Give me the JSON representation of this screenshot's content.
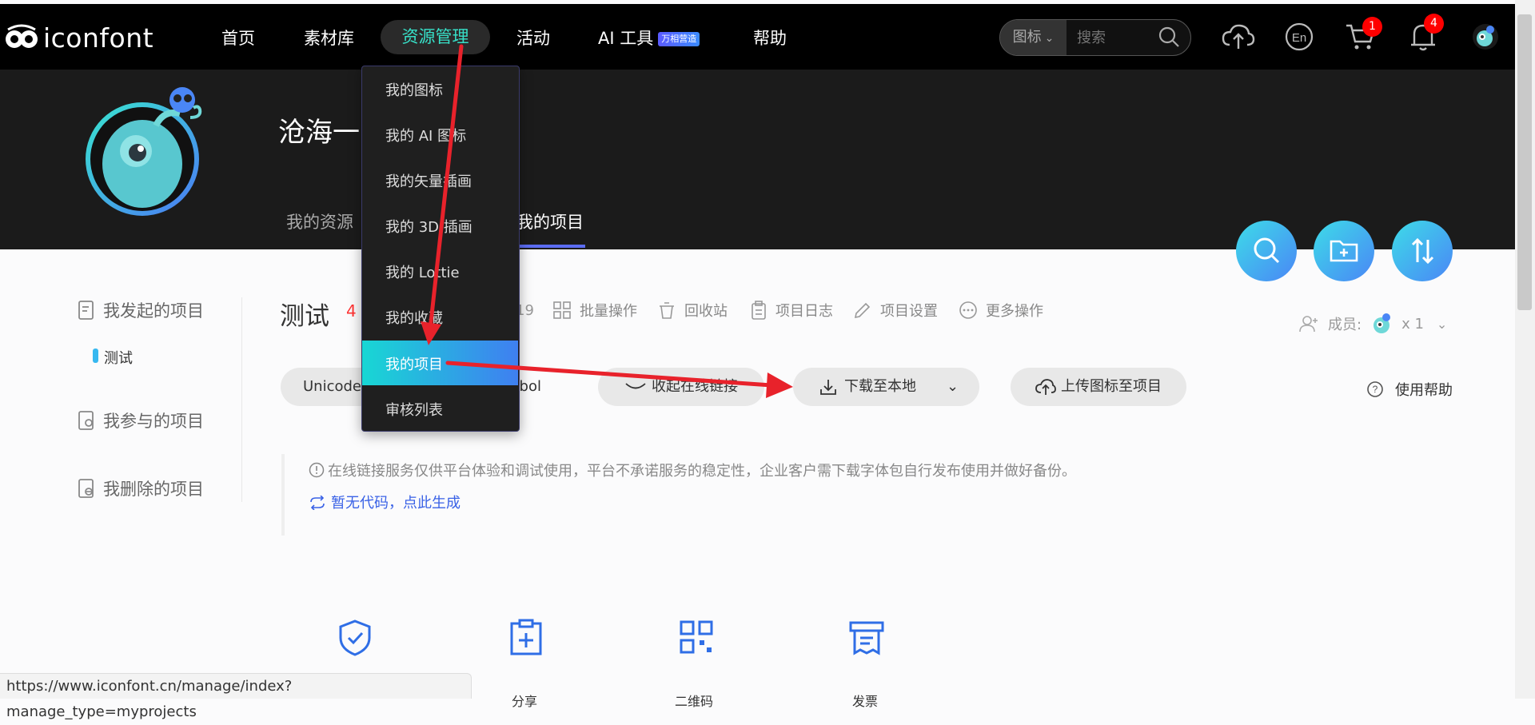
{
  "logo": {
    "text": "iconfont"
  },
  "nav": {
    "items": [
      "首页",
      "素材库",
      "资源管理",
      "活动",
      "AI 工具",
      "帮助"
    ],
    "ai_badge": "万相营造"
  },
  "search": {
    "type_label": "图标",
    "placeholder": "搜索"
  },
  "header_badges": {
    "cart": "1",
    "notifications": "4"
  },
  "hero": {
    "user_name": "沧海一",
    "tabs": [
      "我的资源",
      "我的项目"
    ]
  },
  "sidebar": {
    "started": "我发起的项目",
    "started_items": [
      "测试"
    ],
    "joined": "我参与的项目",
    "deleted": "我删除的项目"
  },
  "project": {
    "title": "测试",
    "count": "4",
    "partial_id": "19",
    "toolbar": [
      "批量操作",
      "回收站",
      "项目日志",
      "项目设置",
      "更多操作"
    ],
    "members_label": "成员:",
    "members_count": "x 1",
    "pills": {
      "unicode": "Unicode",
      "symbol": "mbol",
      "collapse": "收起在线链接",
      "download": "下载至本地",
      "upload": "上传图标至项目"
    },
    "help": "使用帮助",
    "notice": "在线链接服务仅供平台体验和调试使用，平台不承诺服务的稳定性，企业客户需下载字体包自行发布使用并做好备份。",
    "gen_link": "暂无代码，点此生成",
    "bottom_labels": [
      "分享",
      "二维码",
      "发票"
    ]
  },
  "dropdown": {
    "items": [
      "我的图标",
      "我的 AI 图标",
      "我的矢量插画",
      "我的 3D 插画",
      "我的 Lottie",
      "我的收藏",
      "我的项目",
      "审核列表"
    ]
  },
  "status_url": "https://www.iconfont.cn/manage/index?manage_type=myprojects",
  "colors": {
    "accent": "#37e0c8",
    "annotation_arrow": "#e8222b",
    "link": "#3a62e6"
  }
}
